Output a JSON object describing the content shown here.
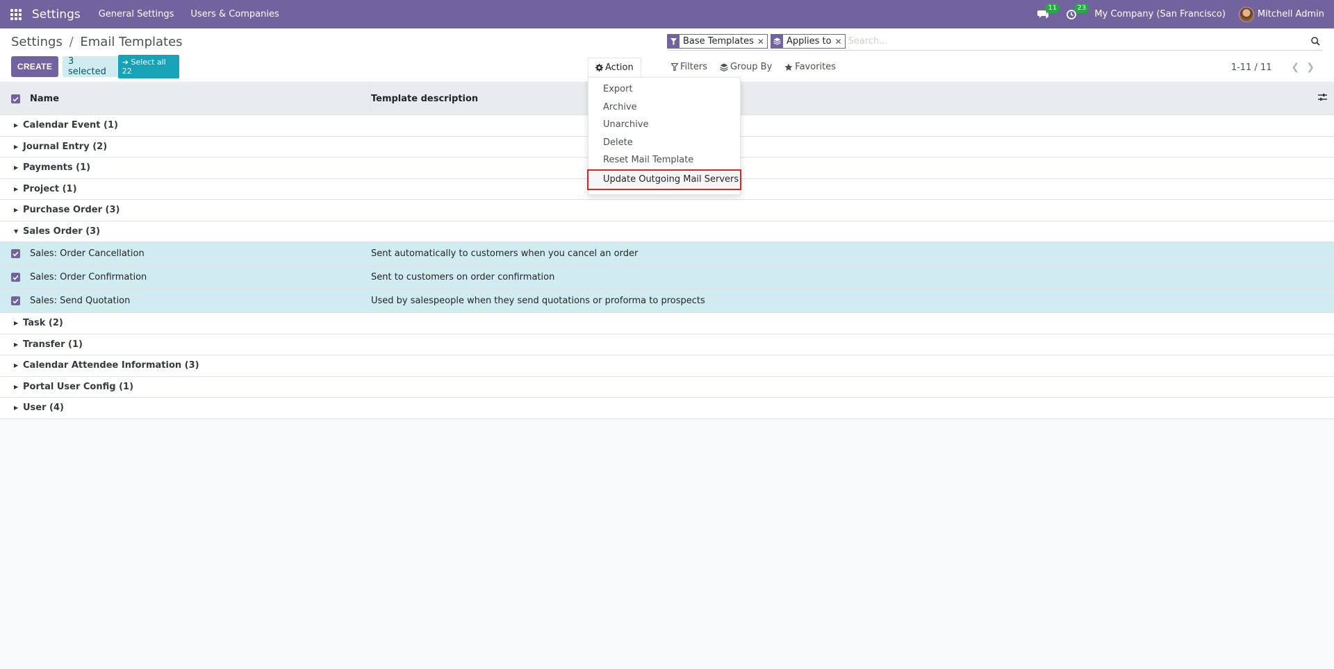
{
  "navbar": {
    "app_title": "Settings",
    "menus": [
      "General Settings",
      "Users & Companies"
    ],
    "messages_count": "11",
    "activities_count": "23",
    "company": "My Company (San Francisco)",
    "user": "Mitchell Admin",
    "bg_color": "#71639e"
  },
  "breadcrumb": {
    "parent": "Settings",
    "separator": "/",
    "current": "Email Templates"
  },
  "toolbar": {
    "create_label": "CREATE",
    "selected_label": "3 selected",
    "select_all_label": "Select all 22",
    "action_label": "Action",
    "filters_label": "Filters",
    "group_by_label": "Group By",
    "favorites_label": "Favorites"
  },
  "search": {
    "facets": [
      {
        "icon": "filter-icon",
        "label": "Base Templates"
      },
      {
        "icon": "layers-icon",
        "label": "Applies to"
      }
    ],
    "placeholder": "Search..."
  },
  "pager": {
    "value": "1-11 / 11"
  },
  "table": {
    "columns": [
      "Name",
      "Template description"
    ]
  },
  "groups_before": [
    "Calendar Event (1)",
    "Journal Entry (2)",
    "Payments (1)",
    "Project (1)",
    "Purchase Order (3)"
  ],
  "open_group": {
    "label": "Sales Order (3)",
    "records": [
      {
        "name": "Sales: Order Cancellation",
        "description": "Sent automatically to customers when you cancel an order"
      },
      {
        "name": "Sales: Order Confirmation",
        "description": "Sent to customers on order confirmation"
      },
      {
        "name": "Sales: Send Quotation",
        "description": "Used by salespeople when they send quotations or proforma to prospects"
      }
    ]
  },
  "groups_after": [
    "Task (2)",
    "Transfer (1)",
    "Calendar Attendee Information (3)",
    "Portal User Config (1)",
    "User (4)"
  ],
  "action_menu": {
    "items": [
      "Export",
      "Archive",
      "Unarchive",
      "Delete",
      "Reset Mail Template",
      "Update Outgoing Mail Servers"
    ],
    "highlighted": "Update Outgoing Mail Servers"
  }
}
